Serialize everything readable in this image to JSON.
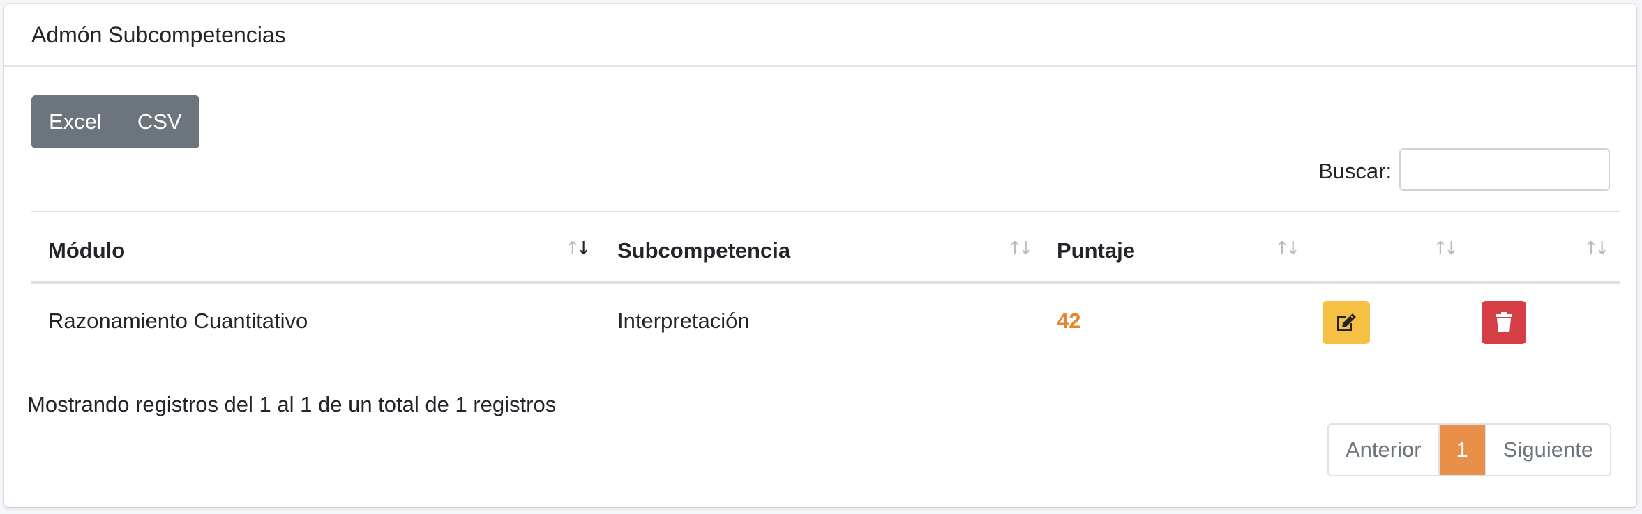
{
  "card": {
    "title": "Admón Subcompetencias"
  },
  "export_buttons": {
    "excel": "Excel",
    "csv": "CSV"
  },
  "search": {
    "label": "Buscar:",
    "value": "",
    "placeholder": ""
  },
  "table": {
    "columns": [
      "Módulo",
      "Subcompetencia",
      "Puntaje",
      "",
      ""
    ],
    "sorted_column": "Módulo",
    "sort_direction": "ascending",
    "rows": [
      {
        "modulo": "Razonamiento Cuantitativo",
        "subcompetencia": "Interpretación",
        "puntaje": "42"
      }
    ]
  },
  "info": "Mostrando registros del 1 al 1 de un total de 1 registros",
  "pagination": {
    "prev": "Anterior",
    "current": "1",
    "next": "Siguiente"
  },
  "colors": {
    "score": "#e8862e",
    "edit_button": "#f6c142",
    "delete_button": "#d43f46",
    "export_buttons": "#6c757d",
    "active_page": "#e8904a"
  },
  "icons": {
    "edit": "edit-icon",
    "delete": "trash-icon",
    "sort": "sort-arrows-icon"
  }
}
